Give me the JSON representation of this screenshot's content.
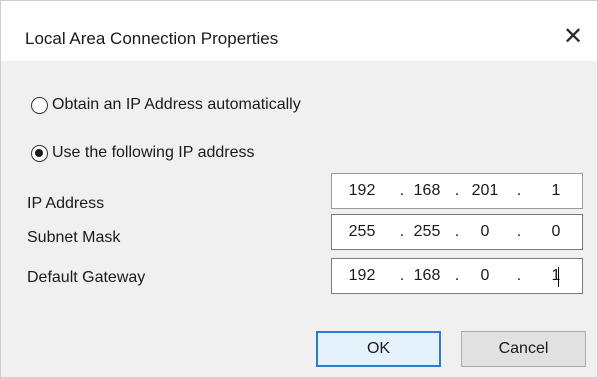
{
  "dialog": {
    "title": "Local Area Connection Properties",
    "close_icon": "close-icon"
  },
  "options": {
    "auto": {
      "label": "Obtain an IP Address automatically",
      "checked": false
    },
    "manual": {
      "label": "Use the following IP address",
      "checked": true
    }
  },
  "fields": {
    "ip": {
      "label": "IP Address",
      "octets": [
        "192",
        "168",
        "201",
        "1"
      ]
    },
    "mask": {
      "label": "Subnet Mask",
      "octets": [
        "255",
        "255",
        "0",
        "0"
      ]
    },
    "gateway": {
      "label": "Default Gateway",
      "octets": [
        "192",
        "168",
        "0",
        "1"
      ]
    }
  },
  "buttons": {
    "ok": "OK",
    "cancel": "Cancel"
  },
  "colors": {
    "accent": "#2a7bd4",
    "dialog_bg": "#f0f0f0",
    "title_bg": "#ffffff"
  }
}
